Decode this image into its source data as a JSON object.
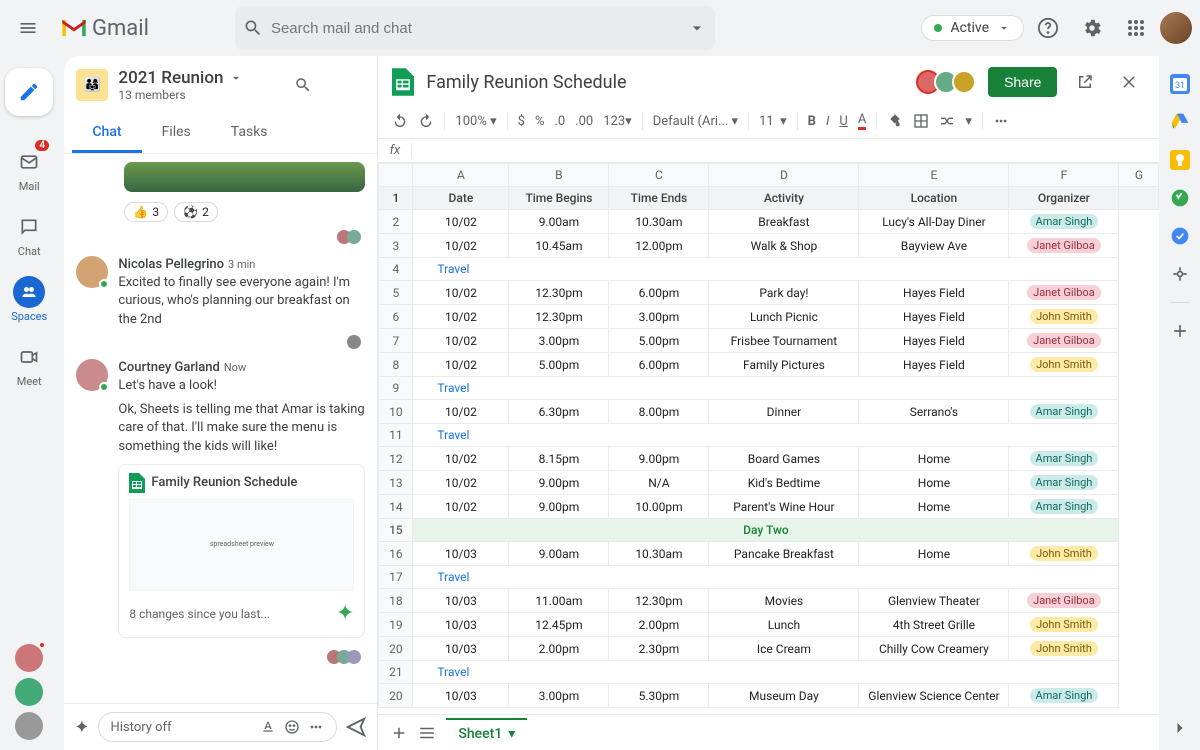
{
  "nav": {
    "compose_color": "#1a73e8",
    "mail": "Mail",
    "mail_badge": "4",
    "chat": "Chat",
    "spaces": "Spaces",
    "meet": "Meet"
  },
  "header": {
    "app": "Gmail",
    "search_placeholder": "Search mail and chat",
    "active": "Active"
  },
  "space": {
    "title": "2021 Reunion",
    "subtitle": "13 members",
    "tabs": {
      "chat": "Chat",
      "files": "Files",
      "tasks": "Tasks"
    },
    "reactions": [
      {
        "emoji": "👍",
        "count": "3"
      },
      {
        "emoji": "⚽",
        "count": "2"
      }
    ],
    "m1": {
      "name": "Nicolas Pellegrino",
      "time": "3 min",
      "text": "Excited to finally see everyone again! I'm curious, who's planning our breakfast on the 2nd"
    },
    "m2": {
      "name": "Courtney Garland",
      "time": "Now",
      "text1": "Let's have a look!",
      "text2": "Ok, Sheets is telling me that Amar is taking care of that. I'll make sure the menu is something the kids will like!"
    },
    "card_title": "Family Reunion Schedule",
    "card_footer": "8 changes since you last...",
    "input_hint": "History off"
  },
  "sheets": {
    "title": "Family Reunion Schedule",
    "share": "Share",
    "zoom": "100%",
    "font": "Default (Ari...",
    "fontsize": "11",
    "sheet_tab": "Sheet1",
    "cols": [
      "A",
      "B",
      "C",
      "D",
      "E",
      "F",
      "G"
    ],
    "header_row": [
      "Date",
      "Time Begins",
      "Time Ends",
      "Activity",
      "Location",
      "Organizer"
    ],
    "rows": [
      {
        "n": "2",
        "d": "10/02",
        "tb": "9.00am",
        "te": "10.30am",
        "a": "Breakfast",
        "l": "Lucy's All-Day Diner",
        "o": "Amar Singh",
        "oc": "teal"
      },
      {
        "n": "3",
        "d": "10/02",
        "tb": "10.45am",
        "te": "12.00pm",
        "a": "Walk & Shop",
        "l": "Bayview Ave",
        "o": "Janet Gilboa",
        "oc": "pink"
      },
      {
        "n": "4",
        "travel": "Travel"
      },
      {
        "n": "5",
        "d": "10/02",
        "tb": "12.30pm",
        "te": "6.00pm",
        "a": "Park day!",
        "l": "Hayes Field",
        "o": "Janet Gilboa",
        "oc": "pink"
      },
      {
        "n": "6",
        "d": "10/02",
        "tb": "12.30pm",
        "te": "3.00pm",
        "a": "Lunch Picnic",
        "l": "Hayes Field",
        "o": "John Smith",
        "oc": "yellow"
      },
      {
        "n": "7",
        "d": "10/02",
        "tb": "3.00pm",
        "te": "5.00pm",
        "a": "Frisbee Tournament",
        "l": "Hayes Field",
        "o": "Janet Gilboa",
        "oc": "pink"
      },
      {
        "n": "8",
        "d": "10/02",
        "tb": "5.00pm",
        "te": "6.00pm",
        "a": "Family Pictures",
        "l": "Hayes Field",
        "o": "John Smith",
        "oc": "yellow"
      },
      {
        "n": "9",
        "travel": "Travel"
      },
      {
        "n": "10",
        "d": "10/02",
        "tb": "6.30pm",
        "te": "8.00pm",
        "a": "Dinner",
        "l": "Serrano's",
        "o": "Amar Singh",
        "oc": "teal"
      },
      {
        "n": "11",
        "travel": "Travel"
      },
      {
        "n": "12",
        "d": "10/02",
        "tb": "8.15pm",
        "te": "9.00pm",
        "a": "Board Games",
        "l": "Home",
        "o": "Amar Singh",
        "oc": "teal"
      },
      {
        "n": "13",
        "d": "10/02",
        "tb": "9.00pm",
        "te": "N/A",
        "a": "Kid's Bedtime",
        "l": "Home",
        "o": "Amar Singh",
        "oc": "teal"
      },
      {
        "n": "14",
        "d": "10/02",
        "tb": "9.00pm",
        "te": "10.00pm",
        "a": "Parent's Wine Hour",
        "l": "Home",
        "o": "Amar Singh",
        "oc": "teal"
      },
      {
        "n": "15",
        "daytwo": "Day Two"
      },
      {
        "n": "16",
        "d": "10/03",
        "tb": "9.00am",
        "te": "10.30am",
        "a": "Pancake Breakfast",
        "l": "Home",
        "o": "John Smith",
        "oc": "yellow"
      },
      {
        "n": "17",
        "travel": "Travel"
      },
      {
        "n": "18",
        "d": "10/03",
        "tb": "11.00am",
        "te": "12.30pm",
        "a": "Movies",
        "l": "Glenview Theater",
        "o": "Janet Gilboa",
        "oc": "pink"
      },
      {
        "n": "19",
        "d": "10/03",
        "tb": "12.45pm",
        "te": "2.00pm",
        "a": "Lunch",
        "l": "4th Street Grille",
        "o": "John Smith",
        "oc": "yellow"
      },
      {
        "n": "20",
        "d": "10/03",
        "tb": "2.00pm",
        "te": "2.30pm",
        "a": "Ice Cream",
        "l": "Chilly Cow Creamery",
        "o": "John Smith",
        "oc": "yellow"
      },
      {
        "n": "21",
        "travel": "Travel"
      },
      {
        "n": "20",
        "d": "10/03",
        "tb": "3.00pm",
        "te": "5.30pm",
        "a": "Museum Day",
        "l": "Glenview Science Center",
        "o": "Amar Singh",
        "oc": "teal"
      }
    ]
  },
  "colors": {
    "accent": "#1a73e8",
    "green": "#188038"
  }
}
